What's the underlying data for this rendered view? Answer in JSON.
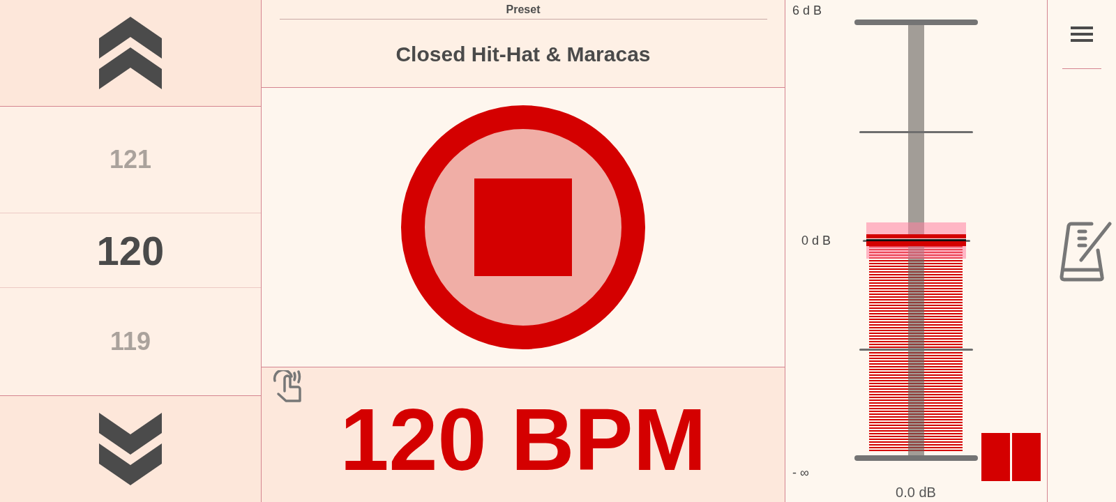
{
  "tempo_picker": {
    "items": [
      {
        "label": "121",
        "selected": false
      },
      {
        "label": "120",
        "selected": true
      },
      {
        "label": "119",
        "selected": false
      }
    ]
  },
  "preset": {
    "label": "Preset",
    "name": "Closed Hit-Hat & Maracas"
  },
  "transport": {
    "playing": true
  },
  "tempo_display": {
    "text": "120 BPM"
  },
  "volume": {
    "scale_labels": [
      "6 d B",
      "0 d B",
      "- ∞"
    ],
    "level": 0.5,
    "reading": "0.0 dB"
  }
}
